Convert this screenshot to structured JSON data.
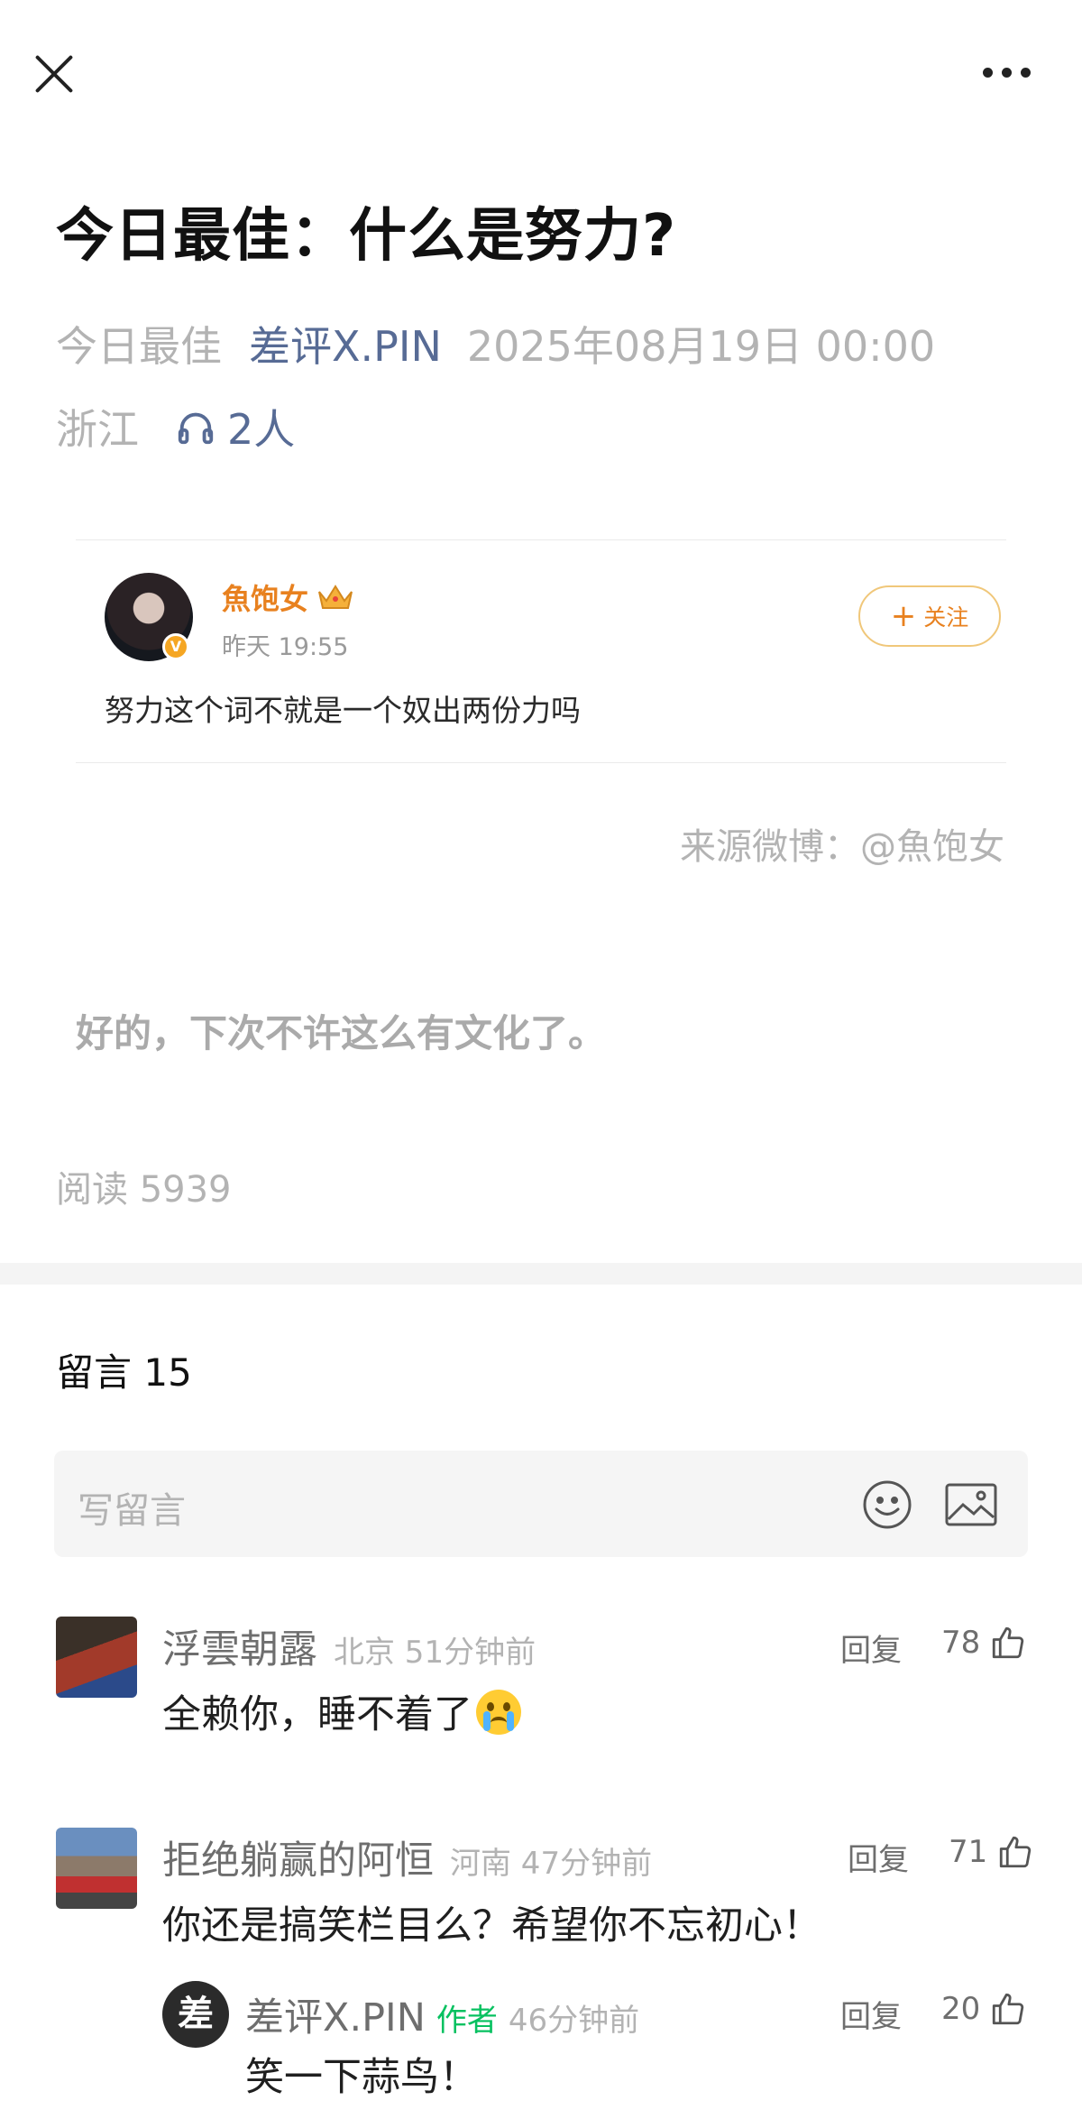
{
  "header": {
    "close_icon": "close-icon",
    "more_icon": "more-icon"
  },
  "article": {
    "title": "今日最佳：什么是努力?",
    "column": "今日最佳",
    "author": "差评X.PIN",
    "datetime": "2025年08月19日 00:00",
    "location": "浙江",
    "listeners": "2人",
    "punchline": "好的，下次不许这么有文化了。",
    "reads": "阅读 5939",
    "source": "来源微博：@魚饱女"
  },
  "weibo_card": {
    "name": "魚饱女",
    "time": "昨天 19:55",
    "follow_label": "关注",
    "text": "努力这个词不就是一个奴出两份力吗",
    "badge": "V"
  },
  "comments": {
    "title": "留言 15",
    "placeholder": "写留言",
    "items": [
      {
        "name": "浮雲朝露",
        "meta": "北京 51分钟前",
        "reply": "回复",
        "likes": "78",
        "text": "全赖你，睡不着了"
      },
      {
        "name": "拒绝躺赢的阿恒",
        "meta": "河南 47分钟前",
        "reply": "回复",
        "likes": "71",
        "text": "你还是搞笑栏目么？希望你不忘初心！",
        "replies": [
          {
            "avatar_char": "差",
            "name": "差评X.PIN",
            "tag": "作者",
            "meta": "46分钟前",
            "reply": "回复",
            "likes": "20",
            "text": "笑一下蒜鸟！"
          }
        ]
      }
    ]
  },
  "colors": {
    "link": "#576b95",
    "weibo_orange": "#e8811f",
    "author_green": "#07c160",
    "muted": "#b3b3b3"
  }
}
